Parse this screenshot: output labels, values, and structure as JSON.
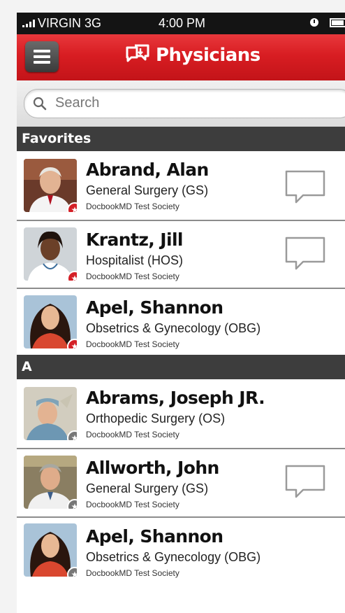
{
  "status_bar": {
    "carrier": "VIRGIN 3G",
    "time": "4:00 PM"
  },
  "nav": {
    "title": "Physicians",
    "menu_icon": "hamburger-icon",
    "title_icon": "chat-bubbles-icon",
    "accent_color": "#d81d22"
  },
  "search": {
    "placeholder": "Search",
    "icon": "search-icon"
  },
  "sections": [
    {
      "header": "Favorites",
      "rows": [
        {
          "name": "Abrand, Alan",
          "specialty": "General Surgery (GS)",
          "society": "DocbookMD Test Society",
          "favorite": true,
          "chat": true
        },
        {
          "name": "Krantz, Jill",
          "specialty": "Hospitalist (HOS)",
          "society": "DocbookMD Test Society",
          "favorite": true,
          "chat": true
        },
        {
          "name": "Apel, Shannon",
          "specialty": "Obsetrics & Gynecology (OBG)",
          "society": "DocbookMD Test Society",
          "favorite": true,
          "chat": false
        }
      ]
    },
    {
      "header": "A",
      "rows": [
        {
          "name": "Abrams, Joseph JR.",
          "specialty": "Orthopedic Surgery (OS)",
          "society": "DocbookMD Test Society",
          "favorite": false,
          "chat": false
        },
        {
          "name": "Allworth, John",
          "specialty": "General Surgery (GS)",
          "society": "DocbookMD Test Society",
          "favorite": false,
          "chat": true
        },
        {
          "name": "Apel, Shannon",
          "specialty": "Obsetrics & Gynecology (OBG)",
          "society": "DocbookMD Test Society",
          "favorite": false,
          "chat": false
        }
      ]
    }
  ]
}
